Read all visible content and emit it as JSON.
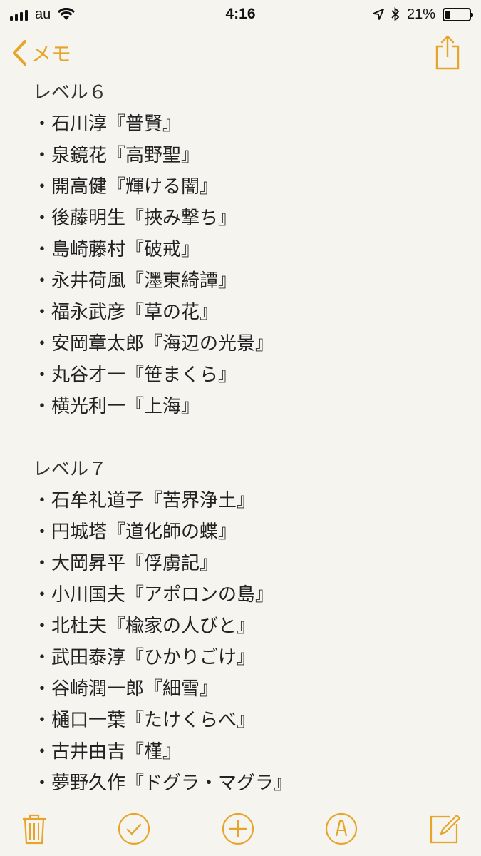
{
  "status_bar": {
    "carrier": "au",
    "time": "4:16",
    "battery": "21%",
    "battery_level": 0.21
  },
  "nav": {
    "back_label": "メモ",
    "share_icon": "share-icon",
    "back_icon": "chevron-left-icon"
  },
  "note": {
    "sections": [
      {
        "heading": "レベル６",
        "items": [
          "・石川淳『普賢』",
          "・泉鏡花『高野聖』",
          "・開高健『輝ける闇』",
          "・後藤明生『挾み撃ち』",
          "・島崎藤村『破戒』",
          "・永井荷風『濹東綺譚』",
          "・福永武彦『草の花』",
          "・安岡章太郎『海辺の光景』",
          "・丸谷才一『笹まくら』",
          "・横光利一『上海』"
        ]
      },
      {
        "heading": "レベル７",
        "items": [
          "・石牟礼道子『苦界浄土』",
          "・円城塔『道化師の蝶』",
          "・大岡昇平『俘虜記』",
          "・小川国夫『アポロンの島』",
          "・北杜夫『楡家の人びと』",
          "・武田泰淳『ひかりごけ』",
          "・谷崎潤一郎『細雪』",
          "・樋口一葉『たけくらべ』",
          "・古井由吉『槿』",
          "・夢野久作『ドグラ・マグラ』"
        ]
      }
    ]
  },
  "toolbar": {
    "icons": [
      "trash-icon",
      "checklist-icon",
      "add-icon",
      "markup-icon",
      "compose-icon"
    ]
  },
  "colors": {
    "accent": "#e6a52a",
    "background": "#f6f4ef"
  }
}
